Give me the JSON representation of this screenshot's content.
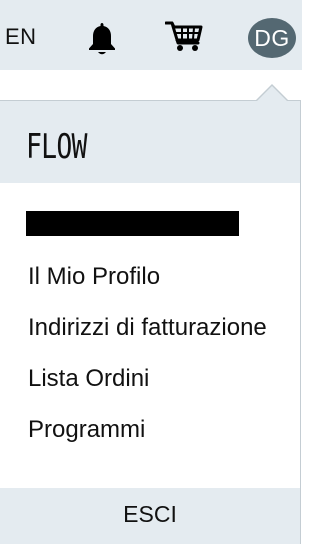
{
  "header": {
    "language": "EN",
    "avatar_initials": "DG",
    "icons": [
      "bell-icon",
      "cart-icon"
    ],
    "colors": {
      "bar_background": "#e4ebf0",
      "avatar_background": "#546872"
    }
  },
  "dropdown": {
    "brand": "FLOW",
    "menu_items": [
      {
        "label": "Il Mio Profilo"
      },
      {
        "label": "Indirizzi di fatturazione"
      },
      {
        "label": "Lista Ordini"
      },
      {
        "label": "Programmi"
      }
    ],
    "logout_label": "ESCI"
  }
}
